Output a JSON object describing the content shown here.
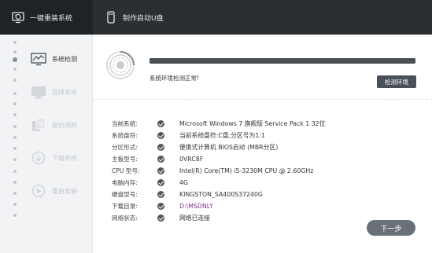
{
  "topbar": {
    "tab_reinstall": "一键重装系统",
    "tab_usb": "制作启动U盘",
    "accent": "#8bc34a"
  },
  "sidebar": {
    "steps": [
      {
        "label": "系统检测",
        "icon": "monitor-chart-icon",
        "active": true
      },
      {
        "label": "选择系统",
        "icon": "desktop-icon",
        "active": false
      },
      {
        "label": "备份资料",
        "icon": "documents-icon",
        "active": false
      },
      {
        "label": "下载系统",
        "icon": "download-icon",
        "active": false
      },
      {
        "label": "重启安装",
        "icon": "restart-icon",
        "active": false
      }
    ]
  },
  "detect": {
    "progress": 1.0,
    "status": "系统环境检测正常!",
    "button": "检测环境"
  },
  "info": {
    "rows": [
      {
        "key": "当前系统:",
        "value": "Microsoft Windows 7 旗舰版 Service Pack 1 32位"
      },
      {
        "key": "系统盘符:",
        "value": "当前系统盘符:C盘,分区号为1:1"
      },
      {
        "key": "分区形式:",
        "value": "便携式计算机 BIOS启动 (MBR分区)"
      },
      {
        "key": "主板型号:",
        "value": "0VRC8F"
      },
      {
        "key": "CPU 型号:",
        "value": "Intel(R) Core(TM) i5-3230M CPU @ 2.60GHz"
      },
      {
        "key": "电脑内存:",
        "value": "4G"
      },
      {
        "key": "硬盘型号:",
        "value": "KINGSTON_SA400S37240G"
      },
      {
        "key": "下载目录:",
        "value": "D:\\MSDNLY"
      },
      {
        "key": "网络状态:",
        "value": "网络已连接"
      }
    ]
  },
  "next_button": "下一步"
}
